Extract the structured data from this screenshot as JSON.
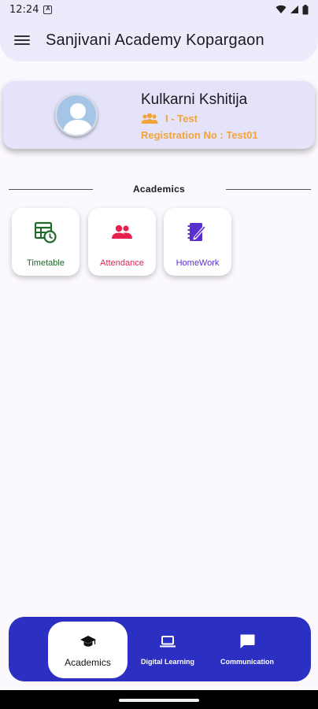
{
  "status_bar": {
    "time": "12:24",
    "notification_glyph": "A"
  },
  "app_bar": {
    "title": "Sanjivani Academy Kopargaon"
  },
  "profile": {
    "name": "Kulkarni Kshitija",
    "class": "I - Test",
    "registration": "Registration No : Test01"
  },
  "section": {
    "title": "Academics"
  },
  "tiles": [
    {
      "label": "Timetable",
      "icon": "timetable-icon",
      "color": "#1e6b2b"
    },
    {
      "label": "Attendance",
      "icon": "attendance-icon",
      "color": "#e9204f"
    },
    {
      "label": "HomeWork",
      "icon": "homework-icon",
      "color": "#5a2fd0"
    }
  ],
  "bottom_nav": {
    "items": [
      {
        "label": "Academics",
        "icon": "graduation-cap-icon",
        "active": true
      },
      {
        "label": "Digital Learning",
        "icon": "laptop-icon",
        "active": false
      },
      {
        "label": "Communication",
        "icon": "chat-icon",
        "active": false
      }
    ]
  },
  "colors": {
    "app_bar": "#ebebfb",
    "profile_card": "#e4e3fa",
    "accent_orange": "#f2a43a",
    "nav_bg": "#2b2fc2"
  }
}
